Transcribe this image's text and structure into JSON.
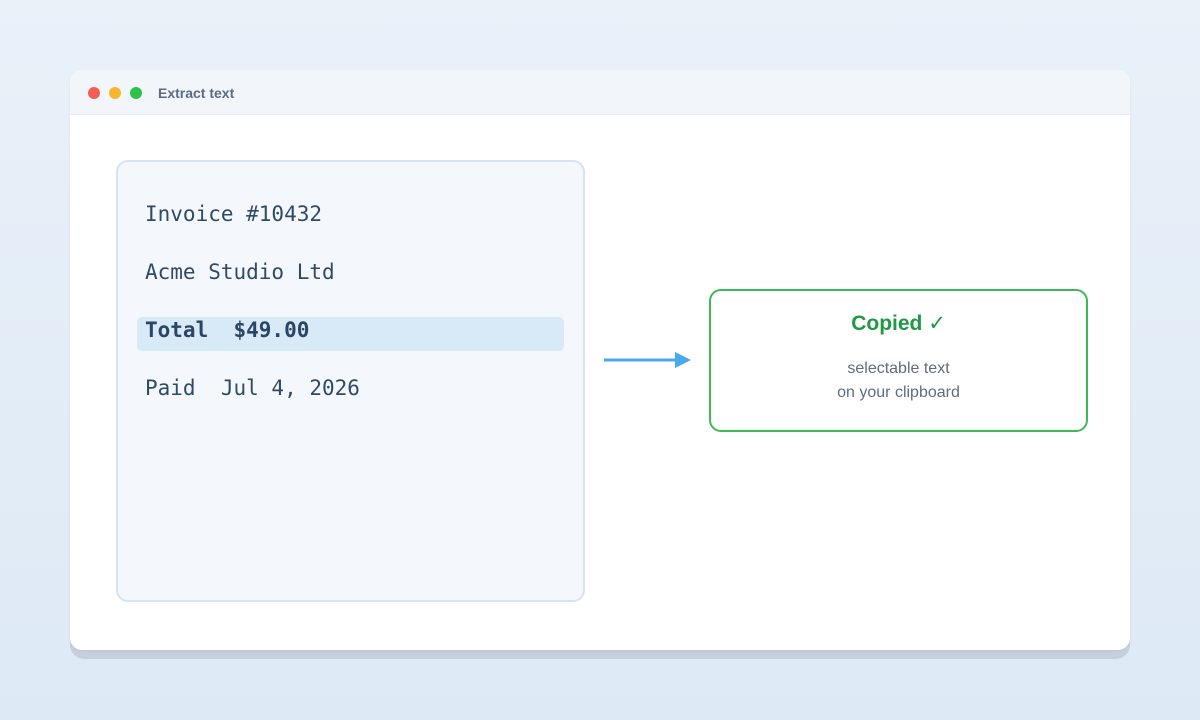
{
  "window": {
    "title": "Extract text",
    "controls": {
      "close_color": "#f25e56",
      "minimize_color": "#f8b62d",
      "maximize_color": "#2dc248"
    }
  },
  "document": {
    "lines": [
      "Invoice #10432",
      "Acme Studio Ltd",
      "Total  $49.00",
      "Paid  Jul 4, 2026"
    ],
    "highlighted_line": "Total  $49.00"
  },
  "arrow": {
    "icon": "arrow-right-icon",
    "color": "#4aa8ee"
  },
  "result": {
    "title": "Copied ✓",
    "lines": [
      "selectable text",
      "on your clipboard"
    ],
    "accent_color": "#3dba55"
  }
}
